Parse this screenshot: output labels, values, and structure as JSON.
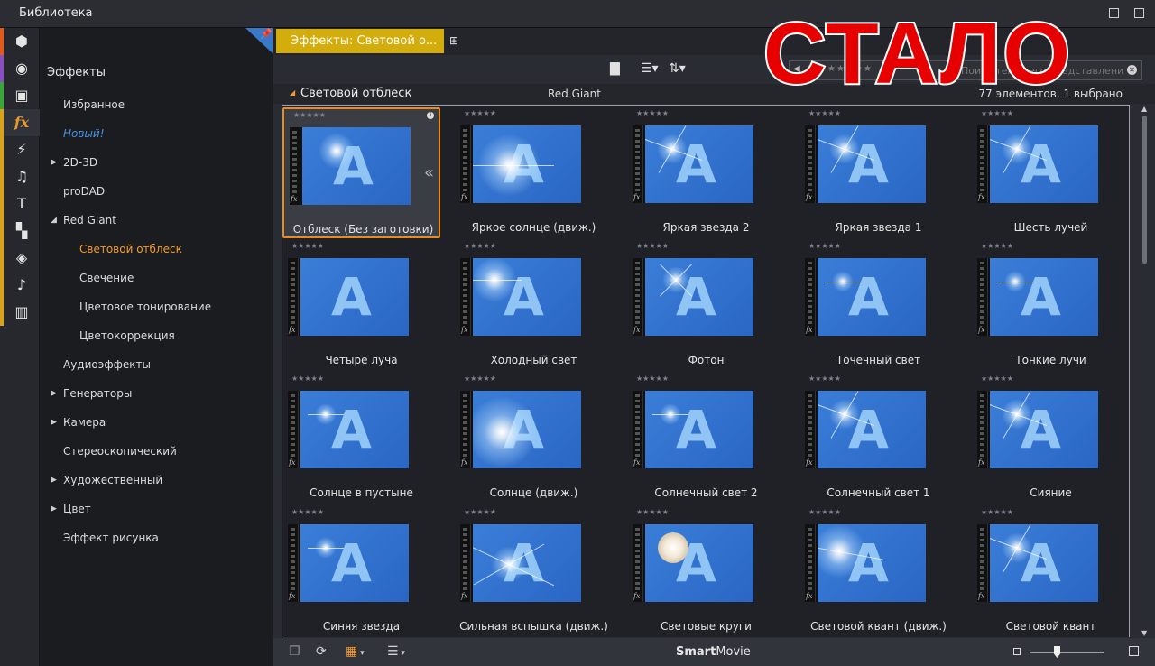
{
  "window": {
    "title": "Библиотека"
  },
  "overlay": {
    "stamp_text": "СТАЛО"
  },
  "icon_strip": [
    {
      "name": "project-bin-icon",
      "glyph": "⬢",
      "color": "#e05a1e"
    },
    {
      "name": "media-icon",
      "glyph": "◉",
      "color": "#8a4fc2"
    },
    {
      "name": "collections-icon",
      "glyph": "▣",
      "color": "#3aa63a"
    },
    {
      "name": "effects-icon",
      "glyph": "fx",
      "color": "#e89a2c"
    },
    {
      "name": "transitions-icon",
      "glyph": "⚡",
      "color": ""
    },
    {
      "name": "music-icon",
      "glyph": "♫",
      "color": ""
    },
    {
      "name": "titles-icon",
      "glyph": "T",
      "color": ""
    },
    {
      "name": "montage-icon",
      "glyph": "▚",
      "color": ""
    },
    {
      "name": "layers-icon",
      "glyph": "◈",
      "color": ""
    },
    {
      "name": "score-icon",
      "glyph": "♪",
      "color": ""
    },
    {
      "name": "piano-icon",
      "glyph": "▥",
      "color": ""
    }
  ],
  "tree": {
    "heading": "Эффекты",
    "items": [
      {
        "label": "Избранное",
        "level": 0,
        "arrow": "",
        "state": ""
      },
      {
        "label": "Новый!",
        "level": 0,
        "arrow": "",
        "state": "new"
      },
      {
        "label": "2D-3D",
        "level": 0,
        "arrow": "▶",
        "state": ""
      },
      {
        "label": "proDAD",
        "level": 0,
        "arrow": "",
        "state": ""
      },
      {
        "label": "Red Giant",
        "level": 0,
        "arrow": "◢",
        "state": ""
      },
      {
        "label": "Световой отблеск",
        "level": 1,
        "arrow": "",
        "state": "selected"
      },
      {
        "label": "Свечение",
        "level": 1,
        "arrow": "",
        "state": ""
      },
      {
        "label": "Цветовое тонирование",
        "level": 1,
        "arrow": "",
        "state": ""
      },
      {
        "label": "Цветокоррекция",
        "level": 1,
        "arrow": "",
        "state": ""
      },
      {
        "label": "Аудиоэффекты",
        "level": 0,
        "arrow": "",
        "state": ""
      },
      {
        "label": "Генераторы",
        "level": 0,
        "arrow": "▶",
        "state": ""
      },
      {
        "label": "Камера",
        "level": 0,
        "arrow": "▶",
        "state": ""
      },
      {
        "label": "Стереоскопический",
        "level": 0,
        "arrow": "",
        "state": ""
      },
      {
        "label": "Художественный",
        "level": 0,
        "arrow": "▶",
        "state": ""
      },
      {
        "label": "Цвет",
        "level": 0,
        "arrow": "▶",
        "state": ""
      },
      {
        "label": "Эффект рисунка",
        "level": 0,
        "arrow": "",
        "state": ""
      }
    ]
  },
  "tab": {
    "label": "Эффекты: Световой о..."
  },
  "search": {
    "placeholder": "Поиск текущего представления",
    "filter_stars": "★★★★★"
  },
  "pathbar": {
    "category": "Световой отблеск",
    "subcategory": "Red Giant",
    "count": "77 элементов, 1 выбрано"
  },
  "items": [
    {
      "label": "Отблеск (Без заготовки)",
      "flare": "soft",
      "selected": true
    },
    {
      "label": "Яркое солнце (движ.)",
      "flare": "sun",
      "selected": false
    },
    {
      "label": "Яркая звезда 2",
      "flare": "star",
      "selected": false
    },
    {
      "label": "Яркая звезда 1",
      "flare": "star",
      "selected": false
    },
    {
      "label": "Шесть лучей",
      "flare": "star",
      "selected": false
    },
    {
      "label": "Четыре луча",
      "flare": "none",
      "selected": false
    },
    {
      "label": "Холодный свет",
      "flare": "cold",
      "selected": false
    },
    {
      "label": "Фотон",
      "flare": "photon",
      "selected": false
    },
    {
      "label": "Точечный свет",
      "flare": "point",
      "selected": false
    },
    {
      "label": "Тонкие лучи",
      "flare": "point",
      "selected": false
    },
    {
      "label": "Солнце в пустыне",
      "flare": "point",
      "selected": false
    },
    {
      "label": "Солнце (движ.)",
      "flare": "pink",
      "selected": false
    },
    {
      "label": "Солнечный свет 2",
      "flare": "point",
      "selected": false
    },
    {
      "label": "Солнечный свет 1",
      "flare": "star",
      "selected": false
    },
    {
      "label": "Сияние",
      "flare": "star",
      "selected": false
    },
    {
      "label": "Синяя звезда",
      "flare": "point",
      "selected": false
    },
    {
      "label": "Сильная вспышка (движ.)",
      "flare": "burst",
      "selected": false
    },
    {
      "label": "Световые круги",
      "flare": "circle",
      "selected": false
    },
    {
      "label": "Световой квант (движ.)",
      "flare": "wide",
      "selected": false
    },
    {
      "label": "Световой квант",
      "flare": "star",
      "selected": false
    }
  ],
  "item_stars": "★★★★★",
  "bottombar": {
    "brand_bold": "Smart",
    "brand_regular": "Movie"
  }
}
